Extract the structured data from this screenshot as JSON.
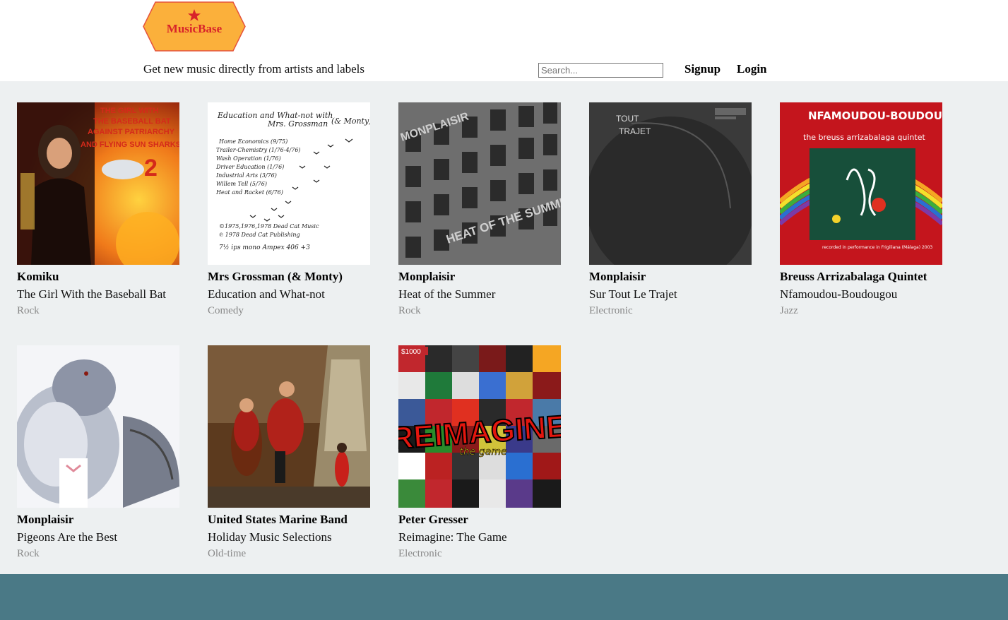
{
  "header": {
    "logo_text": "MusicBase",
    "tagline": "Get new music directly from artists and labels",
    "search_placeholder": "Search...",
    "signup": "Signup",
    "login": "Login"
  },
  "colors": {
    "header_bg": "#ffffff",
    "page_bg": "#edf0f1",
    "footer_bg": "#4a7986",
    "logo_fill": "#fbb03b",
    "logo_text": "#d8232a",
    "genre_text": "#888888"
  },
  "albums": [
    {
      "artist": "Komiku",
      "title": "The Girl With the Baseball Bat",
      "genre": "Rock",
      "cover_text": "THE GIRL WITH THE BASEBALL BAT AGAINST PATRIARCHY AND FLYING SUN SHARKS 2"
    },
    {
      "artist": "Mrs Grossman (& Monty)",
      "title": "Education and What-not",
      "genre": "Comedy",
      "cover_text": "Education and What-not with Mrs. Grossman (& Monty)"
    },
    {
      "artist": "Monplaisir",
      "title": "Heat of the Summer",
      "genre": "Rock",
      "cover_text": "MONPLAISIR HEAT OF THE SUMMER"
    },
    {
      "artist": "Monplaisir",
      "title": "Sur Tout Le Trajet",
      "genre": "Electronic",
      "cover_text": "TOUT TRAJET"
    },
    {
      "artist": "Breuss Arrizabalaga Quintet",
      "title": "Nfamoudou-Boudougou",
      "genre": "Jazz",
      "cover_text": "NFAMOUDOU-BOUDOUGOU the breuss arrizabalaga quintet"
    },
    {
      "artist": "Monplaisir",
      "title": "Pigeons Are the Best",
      "genre": "Rock",
      "cover_text": ""
    },
    {
      "artist": "United States Marine Band",
      "title": "Holiday Music Selections",
      "genre": "Old-time",
      "cover_text": ""
    },
    {
      "artist": "Peter Gresser",
      "title": "Reimagine: The Game",
      "genre": "Electronic",
      "cover_text": "REIMAGINE the game"
    }
  ]
}
